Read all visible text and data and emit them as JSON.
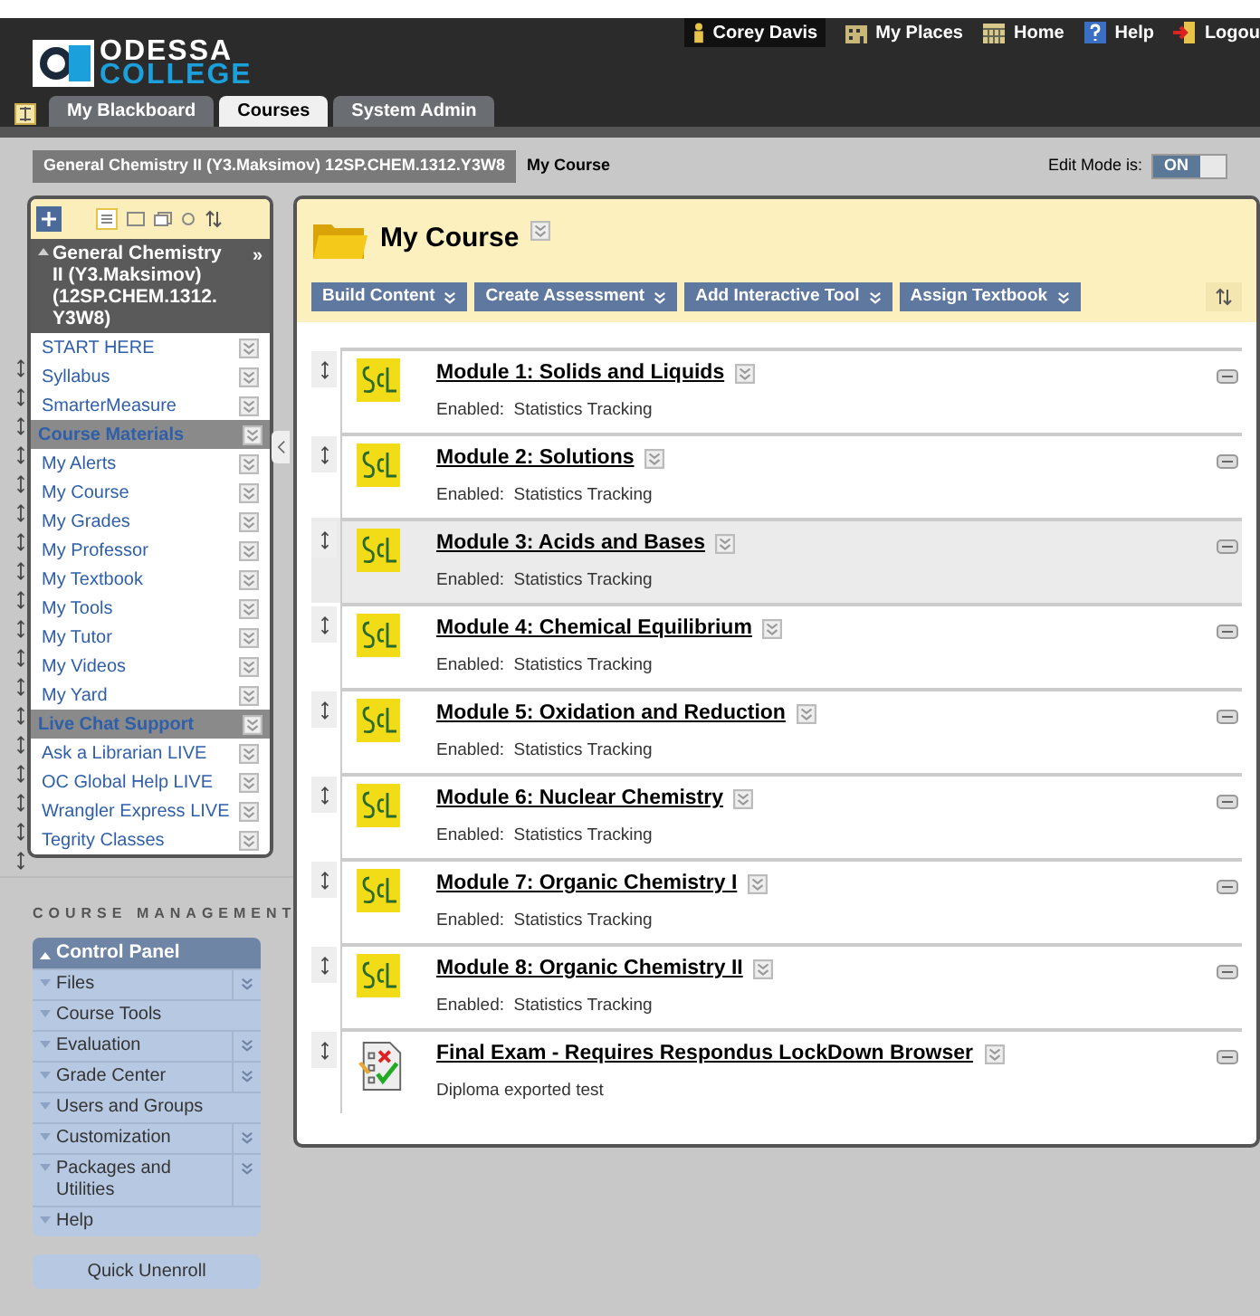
{
  "header": {
    "logo_line1": "ODESSA",
    "logo_line2": "COLLEGE",
    "user": "Corey Davis",
    "links": [
      {
        "kind": "places",
        "label": "My Places"
      },
      {
        "kind": "home",
        "label": "Home"
      },
      {
        "kind": "help",
        "label": "Help"
      },
      {
        "kind": "logout",
        "label": "Logou"
      }
    ]
  },
  "tabs": [
    {
      "label": "My Blackboard",
      "selected": false
    },
    {
      "label": "Courses",
      "selected": true
    },
    {
      "label": "System Admin",
      "selected": false
    }
  ],
  "breadcrumb": {
    "course": "General Chemistry II (Y3.Maksimov) 12SP.CHEM.1312.Y3W8",
    "page": "My Course"
  },
  "edit_mode": {
    "label": "Edit Mode is:",
    "value": "ON",
    "on": true
  },
  "course_menu": {
    "title": "General Chemistry II (Y3.Maksimov) (12SP.CHEM.1312.Y3W8)",
    "expand": "»",
    "items": [
      {
        "kind": "link",
        "label": "START HERE"
      },
      {
        "kind": "link",
        "label": "Syllabus"
      },
      {
        "kind": "link",
        "label": "SmarterMeasure"
      },
      {
        "kind": "heading",
        "label": "Course Materials"
      },
      {
        "kind": "link",
        "label": "My Alerts"
      },
      {
        "kind": "link",
        "label": "My Course"
      },
      {
        "kind": "link",
        "label": "My Grades"
      },
      {
        "kind": "link",
        "label": "My Professor"
      },
      {
        "kind": "link",
        "label": "My Textbook"
      },
      {
        "kind": "link",
        "label": "My Tools"
      },
      {
        "kind": "link",
        "label": "My Tutor"
      },
      {
        "kind": "link",
        "label": "My Videos"
      },
      {
        "kind": "link",
        "label": "My Yard"
      },
      {
        "kind": "heading",
        "label": "Live Chat Support"
      },
      {
        "kind": "link",
        "label": "Ask a Librarian LIVE"
      },
      {
        "kind": "link",
        "label": "OC Global Help LIVE"
      },
      {
        "kind": "link",
        "label": "Wrangler Express LIVE"
      },
      {
        "kind": "link",
        "label": "Tegrity Classes"
      }
    ]
  },
  "course_management": {
    "title": "COURSE MANAGEMENT",
    "panel_title": "Control Panel",
    "items": [
      {
        "label": "Files",
        "flyout": true
      },
      {
        "label": "Course Tools",
        "flyout": false
      },
      {
        "label": "Evaluation",
        "flyout": true
      },
      {
        "label": "Grade Center",
        "flyout": true
      },
      {
        "label": "Users and Groups",
        "flyout": false
      },
      {
        "label": "Customization",
        "flyout": true
      },
      {
        "label": "Packages and Utilities",
        "flyout": true
      },
      {
        "label": "Help",
        "flyout": false
      }
    ],
    "quick_unenroll": "Quick Unenroll"
  },
  "content": {
    "title": "My Course",
    "actions": [
      "Build Content",
      "Create Assessment",
      "Add Interactive Tool",
      "Assign Textbook"
    ],
    "items": [
      {
        "kind": "scl",
        "title": "Module 1: Solids and Liquids",
        "detail": "Enabled:  Statistics Tracking",
        "highlighted": false
      },
      {
        "kind": "scl",
        "title": "Module 2: Solutions",
        "detail": "Enabled:  Statistics Tracking",
        "highlighted": false
      },
      {
        "kind": "scl",
        "title": "Module 3: Acids and Bases",
        "detail": "Enabled:  Statistics Tracking",
        "highlighted": true
      },
      {
        "kind": "scl",
        "title": "Module 4: Chemical Equilibrium",
        "detail": "Enabled:  Statistics Tracking",
        "highlighted": false
      },
      {
        "kind": "scl",
        "title": "Module 5: Oxidation and Reduction",
        "detail": "Enabled:  Statistics Tracking",
        "highlighted": false
      },
      {
        "kind": "scl",
        "title": "Module 6: Nuclear Chemistry",
        "detail": "Enabled:  Statistics Tracking",
        "highlighted": false
      },
      {
        "kind": "scl",
        "title": "Module 7: Organic Chemistry I",
        "detail": "Enabled:  Statistics Tracking",
        "highlighted": false
      },
      {
        "kind": "scl",
        "title": "Module 8: Organic Chemistry II",
        "detail": "Enabled:  Statistics Tracking",
        "highlighted": false
      },
      {
        "kind": "test",
        "title": "Final Exam - Requires Respondus LockDown Browser",
        "detail": "Diploma exported test",
        "highlighted": false
      }
    ]
  }
}
